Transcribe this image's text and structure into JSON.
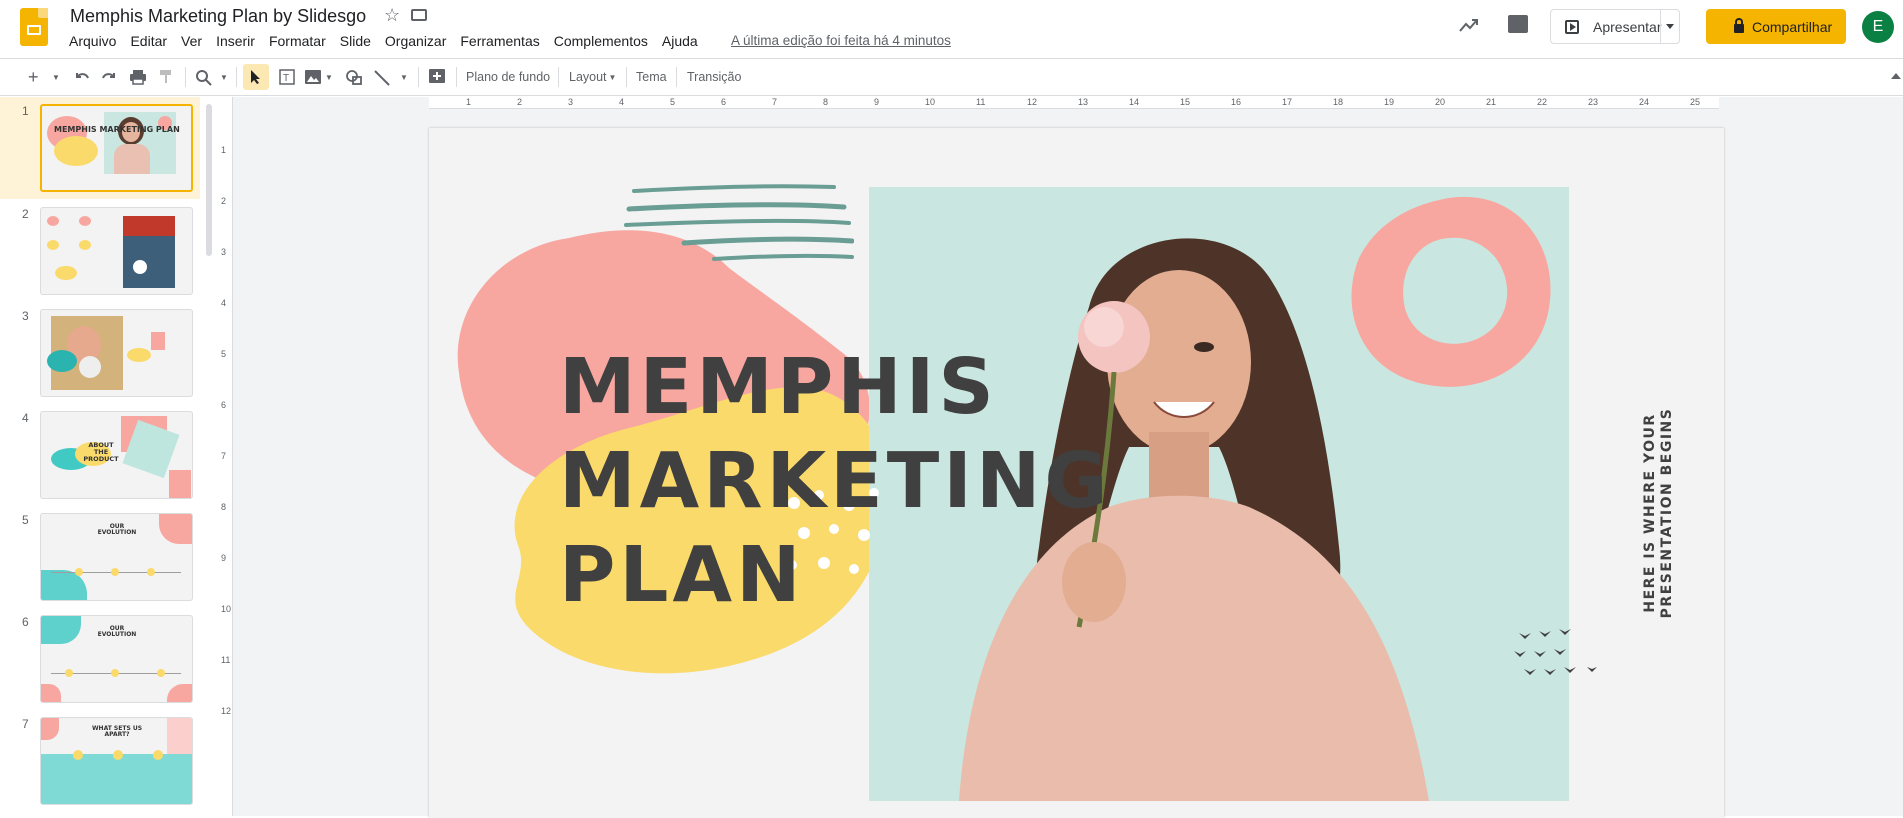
{
  "app": {
    "doc_title": "Memphis Marketing Plan by Slidesgo",
    "menu": [
      "Arquivo",
      "Editar",
      "Ver",
      "Inserir",
      "Formatar",
      "Slide",
      "Organizar",
      "Ferramentas",
      "Complementos",
      "Ajuda"
    ],
    "last_edit": "A última edição foi feita há 4 minutos",
    "present_label": "Apresentar",
    "share_label": "Compartilhar",
    "avatar_letter": "E"
  },
  "toolbar": {
    "background_label": "Plano de fundo",
    "layout_label": "Layout",
    "theme_label": "Tema",
    "transition_label": "Transição"
  },
  "filmstrip": {
    "slides": [
      {
        "number": "1",
        "title": "MEMPHIS MARKETING PLAN"
      },
      {
        "number": "2",
        "title": ""
      },
      {
        "number": "3",
        "title": ""
      },
      {
        "number": "4",
        "title": "ABOUT THE PRODUCT"
      },
      {
        "number": "5",
        "title": "OUR EVOLUTION"
      },
      {
        "number": "6",
        "title": "OUR EVOLUTION"
      },
      {
        "number": "7",
        "title": "WHAT SETS US APART?"
      }
    ],
    "selected": 1
  },
  "rulers": {
    "horizontal": [
      "1",
      "2",
      "3",
      "4",
      "5",
      "6",
      "7",
      "8",
      "9",
      "10",
      "11",
      "12",
      "13",
      "14",
      "15",
      "16",
      "17",
      "18",
      "19",
      "20",
      "21",
      "22",
      "23",
      "24",
      "25"
    ],
    "vertical": [
      "1",
      "2",
      "3",
      "4",
      "5",
      "6",
      "7",
      "8",
      "9",
      "10",
      "11",
      "12"
    ]
  },
  "slide": {
    "title_line1": "MEMPHIS",
    "title_line2": "MARKETING",
    "title_line3": "PLAN",
    "vertical_line1": "HERE IS WHERE YOUR",
    "vertical_line2": "PRESENTATION BEGINS"
  },
  "colors": {
    "accent_yellow": "#f4b400",
    "blob_pink": "#f7a7a0",
    "blob_yellow": "#fada6b",
    "photo_bg": "#c9e7e0",
    "stroke_teal": "#6a9e94",
    "title_text": "#404040"
  }
}
